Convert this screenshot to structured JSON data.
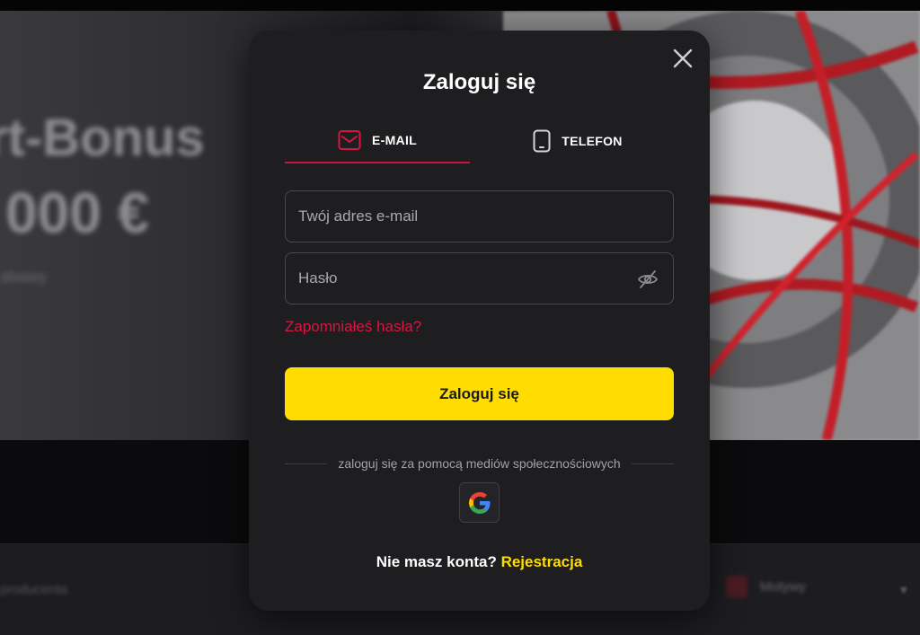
{
  "background": {
    "hero_line1": "rt-Bonus",
    "hero_line2": "000 €",
    "hero_sub": "abawy",
    "filter_left": "producenta",
    "filter_right": "Motywy"
  },
  "modal": {
    "title": "Zaloguj się",
    "tabs": [
      {
        "label": "E-MAIL",
        "active": true,
        "icon": "envelope-icon"
      },
      {
        "label": "TELEFON",
        "active": false,
        "icon": "phone-icon"
      }
    ],
    "email_placeholder": "Twój adres e-mail",
    "password_placeholder": "Hasło",
    "forgot_password": "Zapomniałeś hasła?",
    "login_button": "Zaloguj się",
    "social_text": "zaloguj się za pomocą mediów społecznościowych",
    "social_providers": [
      "google-icon"
    ],
    "no_account_text": "Nie masz konta?",
    "register_link": "Rejestracja"
  },
  "colors": {
    "accent_red": "#d8163f",
    "accent_yellow": "#ffdd00",
    "modal_bg": "#1e1e21"
  }
}
